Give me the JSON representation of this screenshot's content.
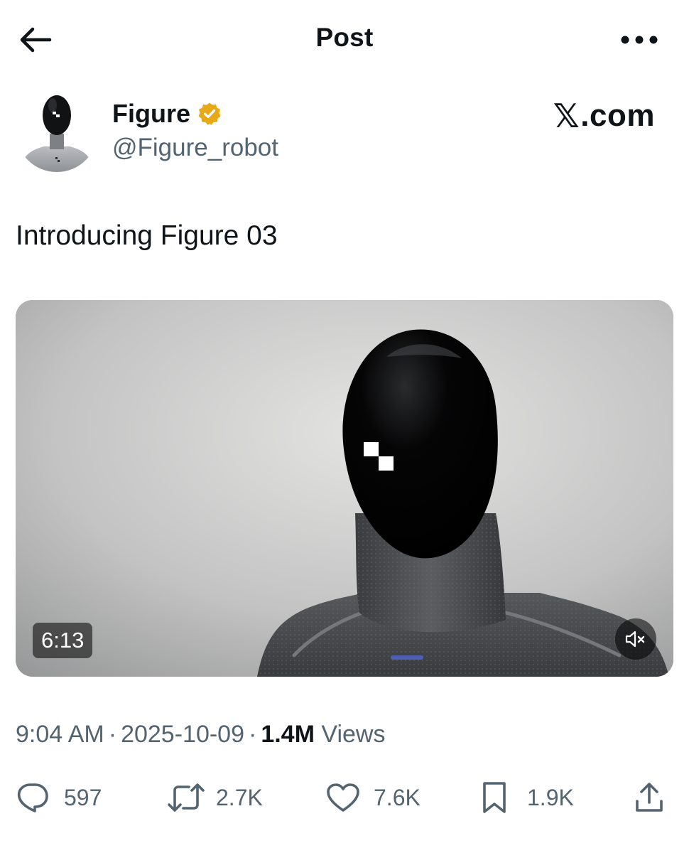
{
  "header": {
    "title": "Post",
    "back_icon": "arrow-left-icon",
    "more_icon": "more-horizontal-icon"
  },
  "author": {
    "display_name": "Figure",
    "handle": "@Figure_robot",
    "verified_icon": "verified-badge-icon",
    "verified_color": "#e8a917"
  },
  "brand": {
    "x_glyph": "𝕏",
    "x_suffix": ".com"
  },
  "post": {
    "text": "Introducing Figure 03"
  },
  "media": {
    "duration": "6:13",
    "mute_icon": "volume-muted-icon"
  },
  "meta": {
    "time": "9:04 AM",
    "separator": "·",
    "date": "2025-10-09",
    "views_count": "1.4M",
    "views_label": "Views"
  },
  "actions": {
    "replies": "597",
    "reposts": "2.7K",
    "likes": "7.6K",
    "bookmarks": "1.9K"
  },
  "colors": {
    "text_primary": "#0f1419",
    "text_secondary": "#536471"
  }
}
